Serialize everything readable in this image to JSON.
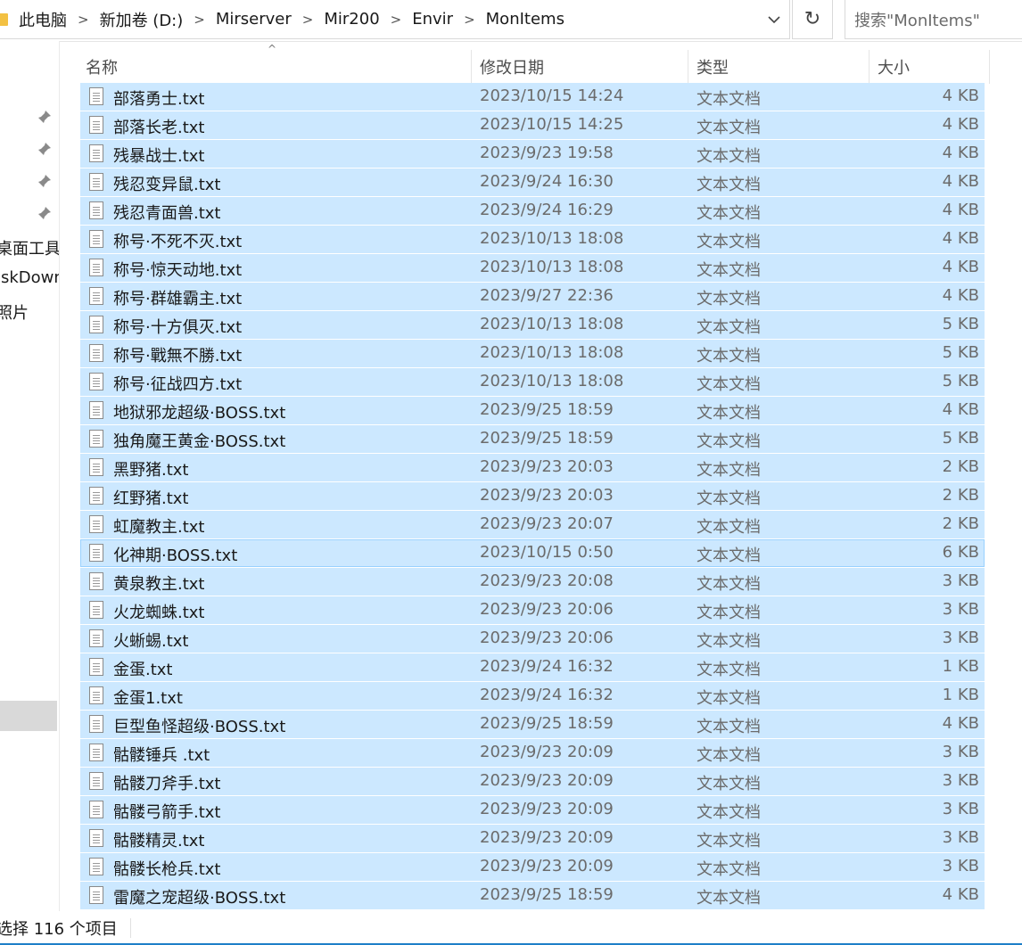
{
  "breadcrumb": [
    "此电脑",
    "新加卷 (D:)",
    "Mirserver",
    "Mir200",
    "Envir",
    "MonItems"
  ],
  "search": {
    "placeholder": "搜索\"MonItems\""
  },
  "nav": {
    "items": [
      "桌面工具",
      "iskDown",
      "照片"
    ]
  },
  "columns": {
    "name": "名称",
    "date": "修改日期",
    "type": "类型",
    "size": "大小"
  },
  "files": [
    {
      "name": "部落勇士.txt",
      "date": "2023/10/15 14:24",
      "type": "文本文档",
      "size": "4 KB"
    },
    {
      "name": "部落长老.txt",
      "date": "2023/10/15 14:25",
      "type": "文本文档",
      "size": "4 KB"
    },
    {
      "name": "残暴战士.txt",
      "date": "2023/9/23 19:58",
      "type": "文本文档",
      "size": "4 KB"
    },
    {
      "name": "残忍变异鼠.txt",
      "date": "2023/9/24 16:30",
      "type": "文本文档",
      "size": "4 KB"
    },
    {
      "name": "残忍青面兽.txt",
      "date": "2023/9/24 16:29",
      "type": "文本文档",
      "size": "4 KB"
    },
    {
      "name": "称号·不死不灭.txt",
      "date": "2023/10/13 18:08",
      "type": "文本文档",
      "size": "4 KB"
    },
    {
      "name": "称号·惊天动地.txt",
      "date": "2023/10/13 18:08",
      "type": "文本文档",
      "size": "4 KB"
    },
    {
      "name": "称号·群雄霸主.txt",
      "date": "2023/9/27 22:36",
      "type": "文本文档",
      "size": "4 KB"
    },
    {
      "name": "称号·十方俱灭.txt",
      "date": "2023/10/13 18:08",
      "type": "文本文档",
      "size": "5 KB"
    },
    {
      "name": "称号·戰無不勝.txt",
      "date": "2023/10/13 18:08",
      "type": "文本文档",
      "size": "5 KB"
    },
    {
      "name": "称号·征战四方.txt",
      "date": "2023/10/13 18:08",
      "type": "文本文档",
      "size": "5 KB"
    },
    {
      "name": "地狱邪龙超级·BOSS.txt",
      "date": "2023/9/25 18:59",
      "type": "文本文档",
      "size": "4 KB"
    },
    {
      "name": "独角魔王黄金·BOSS.txt",
      "date": "2023/9/25 18:59",
      "type": "文本文档",
      "size": "5 KB"
    },
    {
      "name": "黑野猪.txt",
      "date": "2023/9/23 20:03",
      "type": "文本文档",
      "size": "2 KB"
    },
    {
      "name": "红野猪.txt",
      "date": "2023/9/23 20:03",
      "type": "文本文档",
      "size": "2 KB"
    },
    {
      "name": "虹魔教主.txt",
      "date": "2023/9/23 20:07",
      "type": "文本文档",
      "size": "2 KB"
    },
    {
      "name": "化神期·BOSS.txt",
      "date": "2023/10/15 0:50",
      "type": "文本文档",
      "size": "6 KB"
    },
    {
      "name": "黄泉教主.txt",
      "date": "2023/9/23 20:08",
      "type": "文本文档",
      "size": "3 KB"
    },
    {
      "name": "火龙蜘蛛.txt",
      "date": "2023/9/23 20:06",
      "type": "文本文档",
      "size": "3 KB"
    },
    {
      "name": "火蜥蜴.txt",
      "date": "2023/9/23 20:06",
      "type": "文本文档",
      "size": "3 KB"
    },
    {
      "name": "金蛋.txt",
      "date": "2023/9/24 16:32",
      "type": "文本文档",
      "size": "1 KB"
    },
    {
      "name": "金蛋1.txt",
      "date": "2023/9/24 16:32",
      "type": "文本文档",
      "size": "1 KB"
    },
    {
      "name": "巨型鱼怪超级·BOSS.txt",
      "date": "2023/9/25 18:59",
      "type": "文本文档",
      "size": "4 KB"
    },
    {
      "name": "骷髅锤兵 .txt",
      "date": "2023/9/23 20:09",
      "type": "文本文档",
      "size": "3 KB"
    },
    {
      "name": "骷髅刀斧手.txt",
      "date": "2023/9/23 20:09",
      "type": "文本文档",
      "size": "3 KB"
    },
    {
      "name": "骷髅弓箭手.txt",
      "date": "2023/9/23 20:09",
      "type": "文本文档",
      "size": "3 KB"
    },
    {
      "name": "骷髅精灵.txt",
      "date": "2023/9/23 20:09",
      "type": "文本文档",
      "size": "3 KB"
    },
    {
      "name": "骷髅长枪兵.txt",
      "date": "2023/9/23 20:09",
      "type": "文本文档",
      "size": "3 KB"
    },
    {
      "name": "雷魔之宠超级·BOSS.txt",
      "date": "2023/9/25 18:59",
      "type": "文本文档",
      "size": "4 KB"
    }
  ],
  "status": {
    "text": "选择 116 个项目"
  },
  "colors": {
    "selection": "#cce8ff",
    "focus_border": "#99d1ff",
    "accent": "#1e7fc8"
  }
}
